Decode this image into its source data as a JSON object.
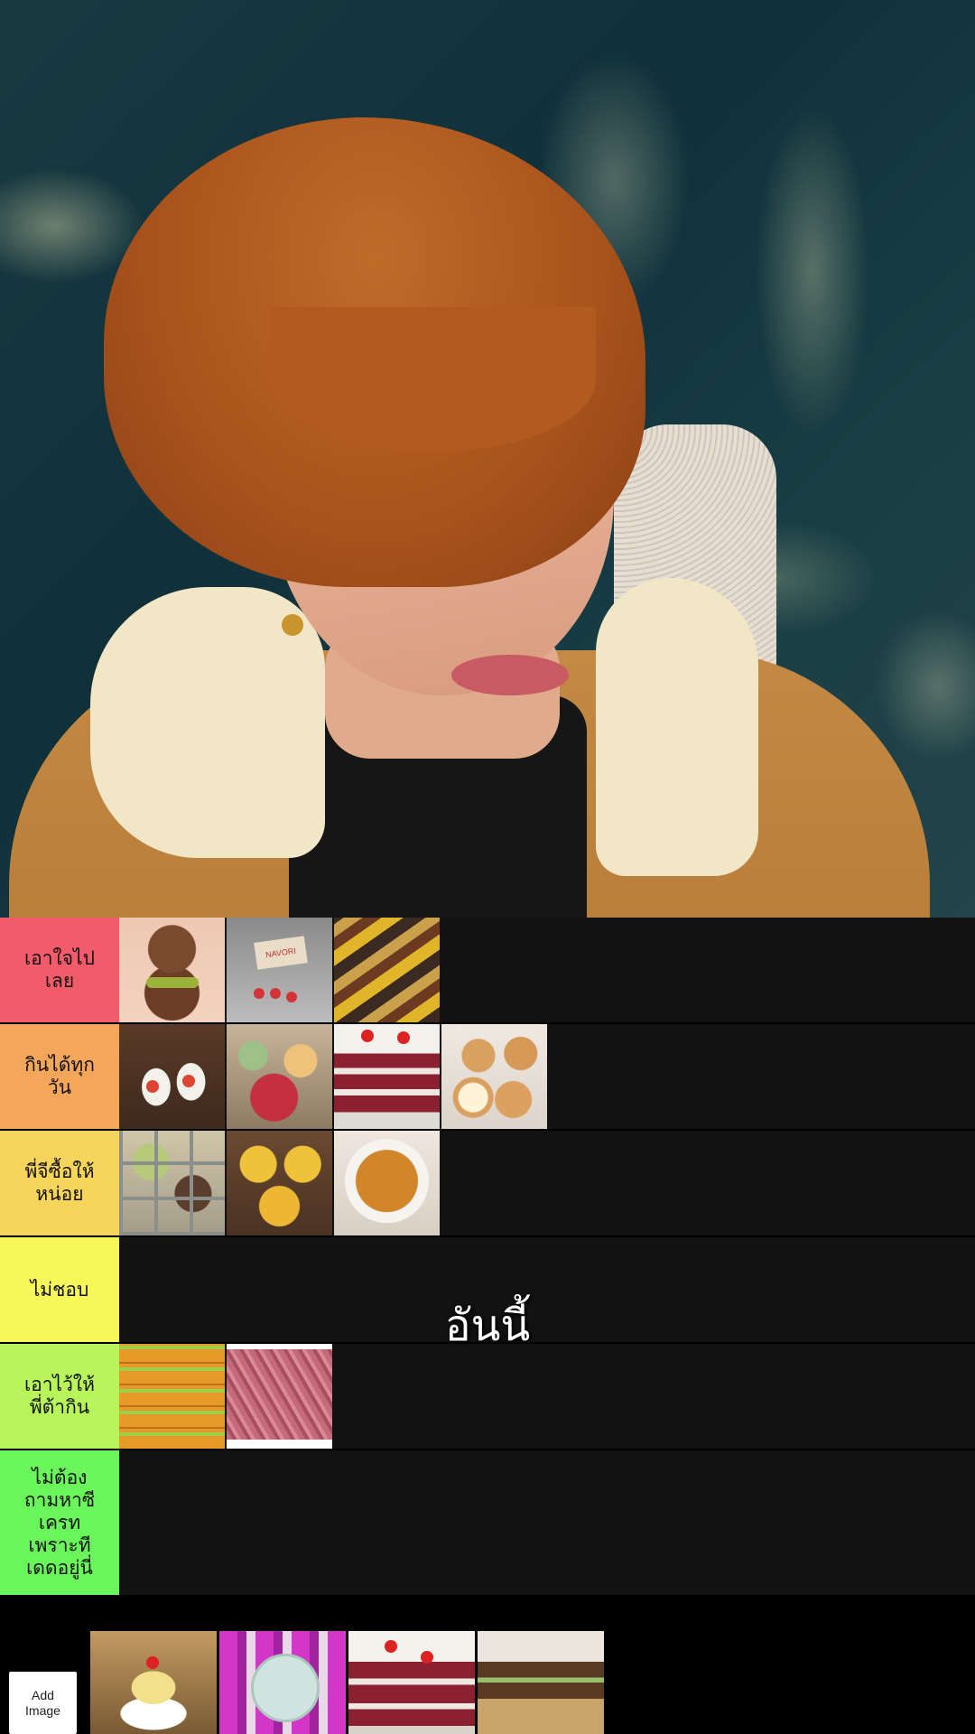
{
  "subtitle": "อันนี้",
  "tiers": [
    {
      "label": "เอาใจไป\nเลย",
      "color": "#f25c6a",
      "items": [
        "matcha-ball",
        "navori",
        "toblerone"
      ]
    },
    {
      "label": "กินได้ทุก\nวัน",
      "color": "#f4a65a",
      "items": [
        "strawberry-mochi",
        "fruit-tart",
        "red-velvet-cake",
        "cream-puff"
      ]
    },
    {
      "label": "พี่จีซื้อให้\nหน่อย",
      "color": "#f7d45a",
      "items": [
        "ice-cream-toppings",
        "cookie-tart",
        "creme-brulee"
      ]
    },
    {
      "label": "ไม่ชอบ",
      "color": "#f7f75a",
      "items": []
    },
    {
      "label": "เอาไว้ให้\nพี่ต้ากิน",
      "color": "#b8f55a",
      "items": [
        "sausage-snack",
        "pink-sticks"
      ]
    },
    {
      "label": "ไม่ต้อง\nถามหาซี\nเครท\nเพราะที\nเดดอยู่นี่",
      "color": "#6af55a",
      "items": []
    }
  ],
  "tray": {
    "add_label": "Add\nImage",
    "items": [
      "custard-pudding",
      "pink-candy-pack",
      "strawberry-cake",
      "chocolate-bar"
    ]
  }
}
